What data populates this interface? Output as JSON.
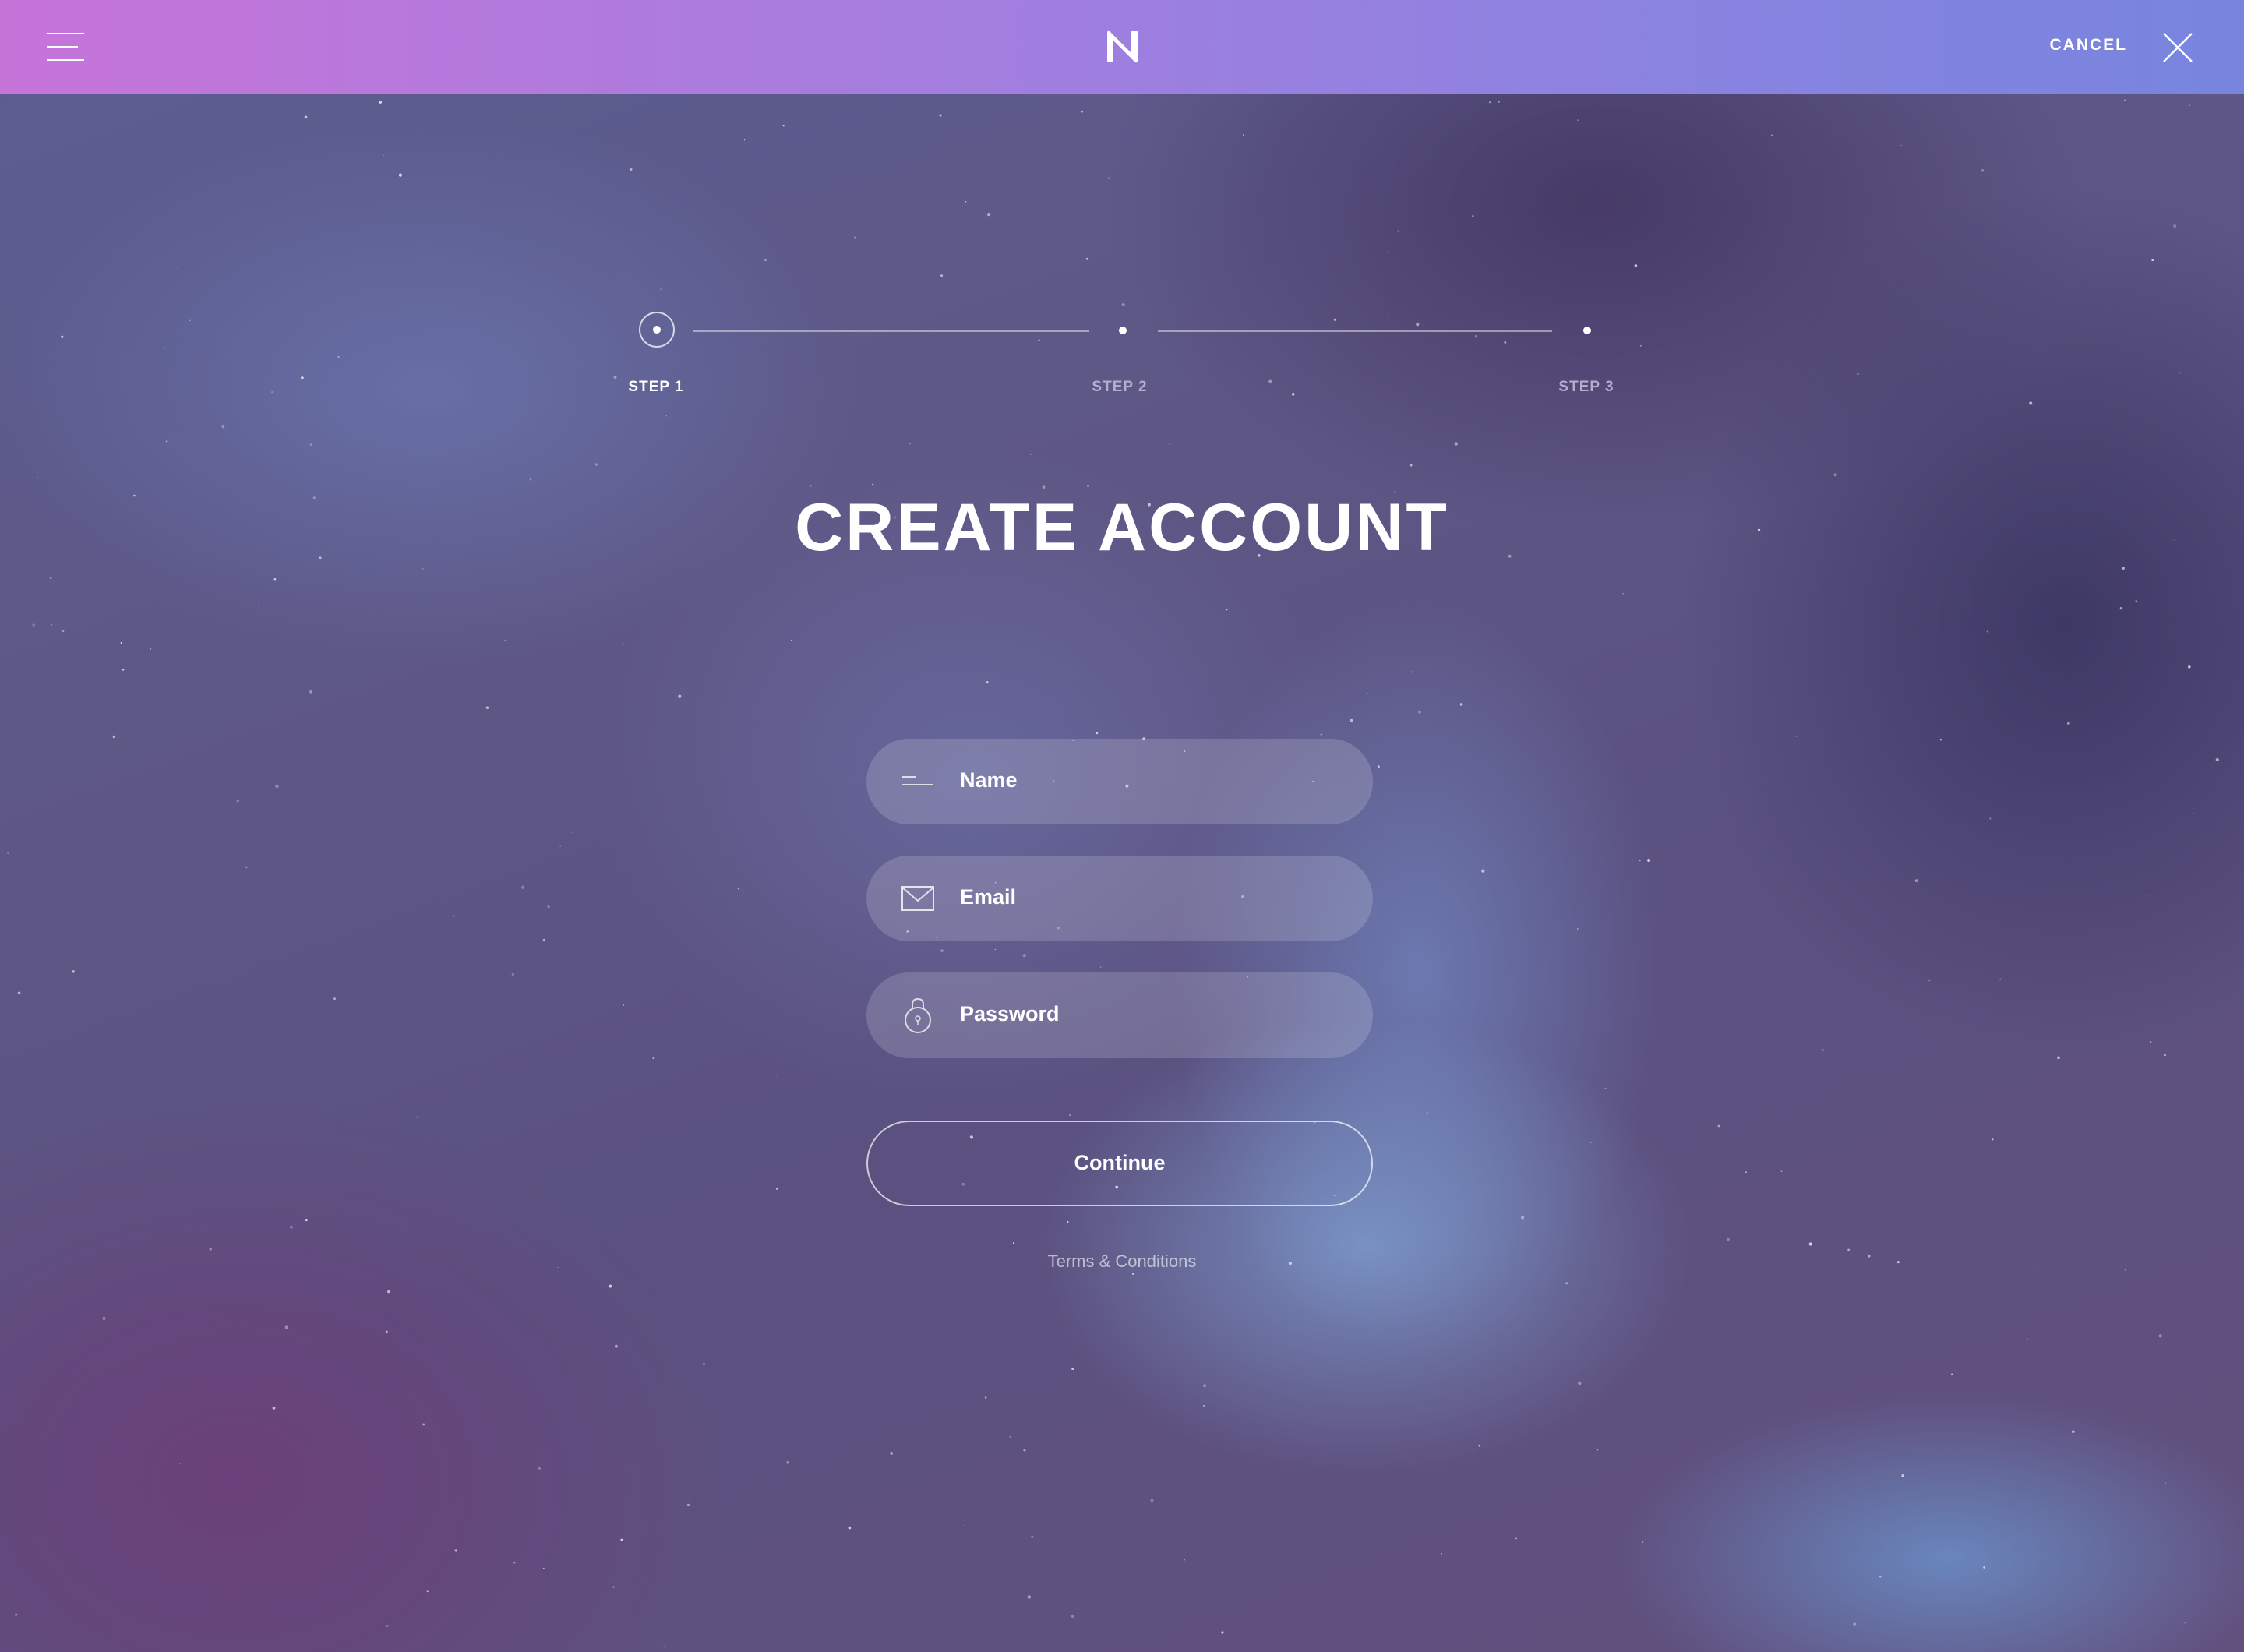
{
  "header": {
    "menu_icon": "hamburger-menu-icon",
    "logo_letter": "N",
    "cancel_label": "CANCEL",
    "close_icon": "close-icon",
    "gradient": [
      "#c774d9",
      "#7785de"
    ]
  },
  "stepper": {
    "steps": [
      {
        "label": "STEP 1",
        "state": "active"
      },
      {
        "label": "STEP 2",
        "state": "inactive"
      },
      {
        "label": "STEP 3",
        "state": "inactive"
      }
    ],
    "active_color": "#ffffff",
    "inactive_color": "#b3aed0"
  },
  "form": {
    "title": "CREATE ACCOUNT",
    "fields": [
      {
        "label": "Name",
        "icon": "name-lines-icon"
      },
      {
        "label": "Email",
        "icon": "envelope-icon"
      },
      {
        "label": "Password",
        "icon": "lock-icon"
      }
    ],
    "continue_label": "Continue",
    "terms_label": "Terms & Conditions"
  }
}
